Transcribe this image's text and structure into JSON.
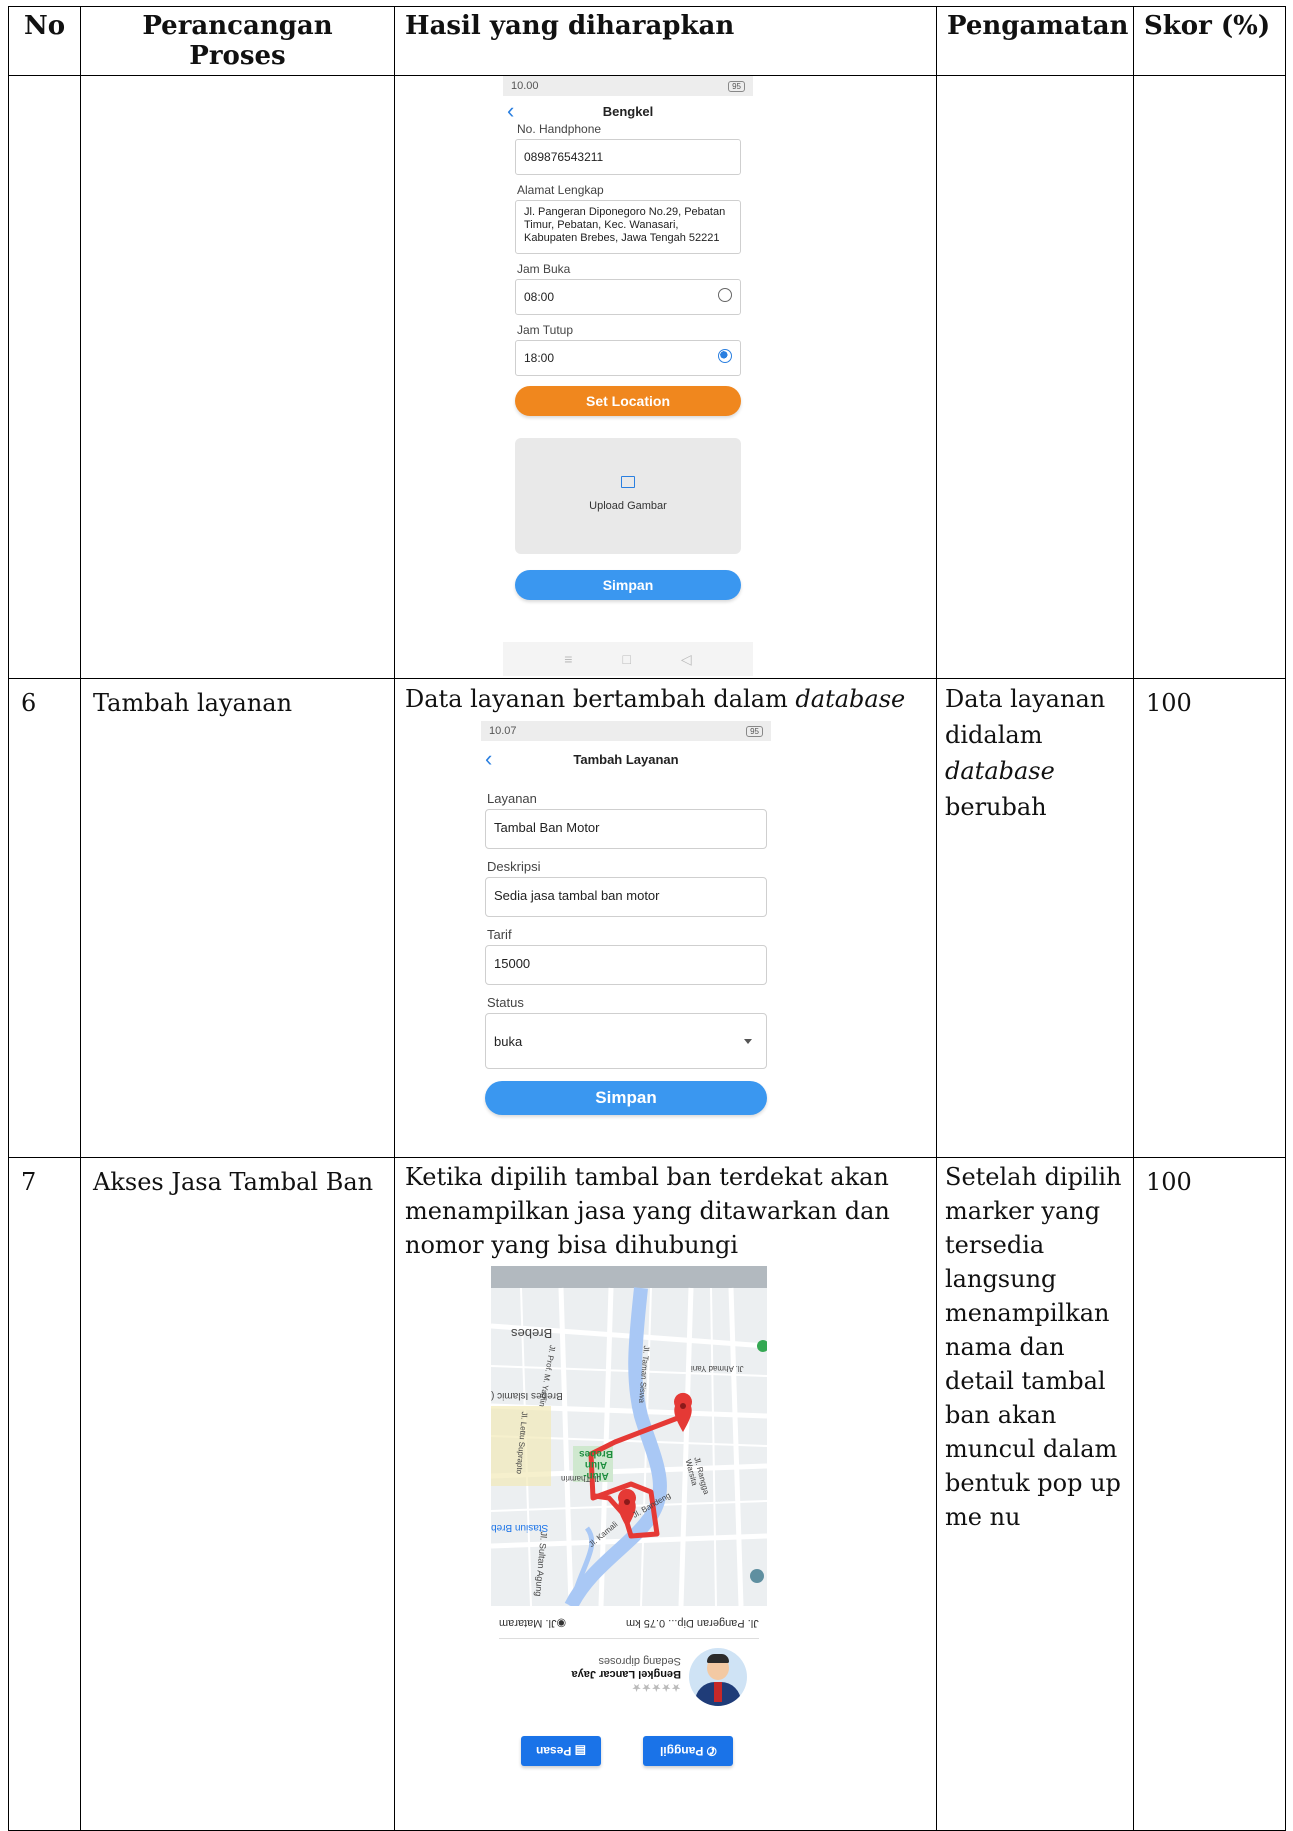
{
  "table": {
    "headers": [
      "No",
      "Perancangan Proses",
      "Hasil yang diharapkan",
      "Pengamatan",
      "Skor (%)"
    ],
    "rows": [
      {
        "no": "",
        "process": "",
        "expected": "",
        "observation": "",
        "score": "",
        "screen": {
          "status_time": "10.00",
          "battery": "95",
          "title": "Bengkel",
          "phone_label": "No. Handphone",
          "phone_value": "089876543211",
          "address_label": "Alamat Lengkap",
          "address_value": "Jl. Pangeran Diponegoro No.29, Pebatan Timur, Pebatan, Kec. Wanasari, Kabupaten Brebes, Jawa Tengah 52221",
          "open_label": "Jam Buka",
          "open_value": "08:00",
          "close_label": "Jam Tutup",
          "close_value": "18:00",
          "location_button": "Set Location",
          "upload_label": "Upload Gambar",
          "save_button": "Simpan"
        }
      },
      {
        "no": "6",
        "process": "Tambah layanan",
        "expected_prefix": "Data layanan bertambah dalam ",
        "expected_italic": "database",
        "observation_1": "Data layanan didalam",
        "observation_italic": "database",
        "observation_2": "berubah",
        "score": "100",
        "screen": {
          "status_time": "10.07",
          "battery": "95",
          "title": "Tambah Layanan",
          "service_label": "Layanan",
          "service_value": "Tambal Ban Motor",
          "desc_label": "Deskripsi",
          "desc_value": "Sedia jasa tambal ban motor",
          "tarif_label": "Tarif",
          "tarif_value": "15000",
          "status_label": "Status",
          "status_value": "buka",
          "save_button": "Simpan"
        }
      },
      {
        "no": "7",
        "process": "Akses Jasa Tambal Ban",
        "expected": "Ketika dipilih tambal ban terdekat akan menampilkan jasa yang ditawarkan dan nomor yang bisa dihubungi",
        "observation": "Setelah dipilih marker yang tersedia langsung menampilkan nama dan detail tambal ban akan muncul dalam bentuk pop up me nu",
        "score": "100",
        "screen": {
          "map_labels": [
            "Brebes",
            "Brebes Islamic (",
            "Alun-Alun Brebes",
            "Stasiun Breb",
            "Jl. Prof. M. Yamin",
            "Jl. Taman Siswa",
            "Jl. Lettu Suprapto",
            "Jl. Thamrin",
            "Jl. Rangga Warsita",
            "Jl. Kamali",
            "Jl. Sultan Agung",
            "Jl. Ahmad Yani",
            "Jl. Bandeng"
          ],
          "route_from": "Jl. Mataram",
          "route_to": "Jl. Pangeran Dip...",
          "distance": "0.75 km",
          "shop_status": "Sedang diproses",
          "shop_name": "Bengkel Lancar Jaya",
          "rating": "★★★★★",
          "call_button": "Panggil",
          "message_button": "Pesan"
        }
      }
    ]
  }
}
